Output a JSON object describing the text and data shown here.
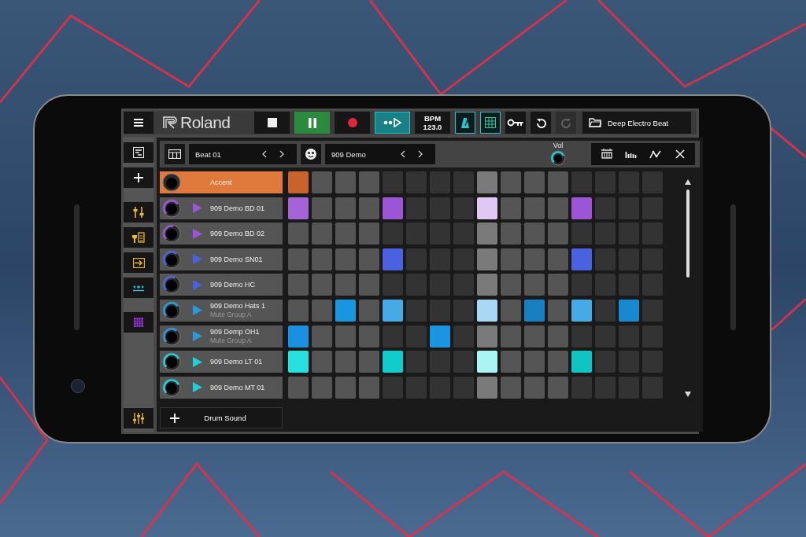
{
  "top_bar": {
    "logo": {
      "text": "Roland"
    },
    "transport": [
      {
        "kind": "stop",
        "on": false
      },
      {
        "kind": "pause",
        "on": true
      },
      {
        "kind": "record",
        "on": false
      },
      {
        "kind": "step",
        "on": true
      }
    ],
    "bpm": {
      "label": "BPM",
      "value": "123.0"
    },
    "toggles": [
      {
        "kind": "metronome",
        "on": true
      },
      {
        "kind": "grid",
        "on": true
      }
    ],
    "tools": [
      {
        "kind": "key",
        "disabled": false
      },
      {
        "kind": "undo",
        "disabled": false
      },
      {
        "kind": "redo",
        "disabled": true
      }
    ],
    "project": "Deep Electro Beat"
  },
  "sidebar": {
    "groups": [
      {
        "items": [
          {
            "kind": "list"
          },
          {
            "kind": "add"
          }
        ]
      },
      {
        "items": [
          {
            "kind": "tune"
          },
          {
            "kind": "edit"
          },
          {
            "kind": "import"
          },
          {
            "kind": "arrange"
          }
        ]
      },
      {
        "items": [
          {
            "kind": "grid"
          }
        ]
      },
      {
        "items": [
          {
            "kind": "mixer"
          }
        ]
      }
    ]
  },
  "pattern_bar": {
    "pattern": "Beat 01",
    "kit": "909 Demo",
    "volume": {
      "label": "Vol",
      "level": 0.75
    },
    "view_buttons": [
      {
        "kind": "drum-kit"
      },
      {
        "kind": "velocity"
      },
      {
        "kind": "automation"
      },
      {
        "kind": "close"
      }
    ]
  },
  "step_columns": [
    {
      "current": false
    },
    {
      "current": false
    },
    {
      "current": false
    },
    {
      "current": false
    },
    {
      "current": false
    },
    {
      "current": false
    },
    {
      "current": false
    },
    {
      "current": false
    },
    {
      "current": true
    },
    {
      "current": false
    },
    {
      "current": false
    },
    {
      "current": false
    },
    {
      "current": false
    },
    {
      "current": false
    },
    {
      "current": false
    },
    {
      "current": false
    }
  ],
  "tracks": [
    {
      "kind": "accent",
      "name": "Accent",
      "selected": true,
      "steps": [
        {
          "on": true,
          "color": "#c8632e"
        },
        {
          "on": false
        },
        {
          "on": false
        },
        {
          "on": false
        },
        {
          "on": false
        },
        {
          "on": false
        },
        {
          "on": false
        },
        {
          "on": false
        },
        {
          "on": false
        },
        {
          "on": false
        },
        {
          "on": false
        },
        {
          "on": false
        },
        {
          "on": false
        },
        {
          "on": false
        },
        {
          "on": false
        },
        {
          "on": false
        }
      ]
    },
    {
      "kind": "sound",
      "name": "909 Demo BD 01",
      "selected": false,
      "color": "#9b55d6",
      "level": 0.7,
      "steps": [
        {
          "on": true,
          "color": "#a464d8"
        },
        {
          "on": false
        },
        {
          "on": false
        },
        {
          "on": false
        },
        {
          "on": true,
          "color": "#9b55d6"
        },
        {
          "on": false
        },
        {
          "on": false
        },
        {
          "on": false
        },
        {
          "on": true,
          "color": "#e0c8f4"
        },
        {
          "on": false
        },
        {
          "on": false
        },
        {
          "on": false
        },
        {
          "on": true,
          "color": "#9b55d6"
        },
        {
          "on": false
        },
        {
          "on": false
        },
        {
          "on": false
        }
      ]
    },
    {
      "kind": "sound",
      "name": "909 Demo BD 02",
      "selected": false,
      "color": "#9b55d6",
      "level": 0.55,
      "steps": [
        {
          "on": false
        },
        {
          "on": false
        },
        {
          "on": false
        },
        {
          "on": false
        },
        {
          "on": false
        },
        {
          "on": false
        },
        {
          "on": false
        },
        {
          "on": false
        },
        {
          "on": false
        },
        {
          "on": false
        },
        {
          "on": false
        },
        {
          "on": false
        },
        {
          "on": false
        },
        {
          "on": false
        },
        {
          "on": false
        },
        {
          "on": false
        }
      ]
    },
    {
      "kind": "sound",
      "name": "909 Demo SN01",
      "selected": false,
      "color": "#4a62e0",
      "level": 0.65,
      "steps": [
        {
          "on": false
        },
        {
          "on": false
        },
        {
          "on": false
        },
        {
          "on": false
        },
        {
          "on": true,
          "color": "#4a62e0"
        },
        {
          "on": false
        },
        {
          "on": false
        },
        {
          "on": false
        },
        {
          "on": false
        },
        {
          "on": false
        },
        {
          "on": false
        },
        {
          "on": false
        },
        {
          "on": true,
          "color": "#4a62e0"
        },
        {
          "on": false
        },
        {
          "on": false
        },
        {
          "on": false
        }
      ]
    },
    {
      "kind": "sound",
      "name": "909 Demo HC",
      "selected": false,
      "color": "#4a62e0",
      "level": 0.6,
      "steps": [
        {
          "on": false
        },
        {
          "on": false
        },
        {
          "on": false
        },
        {
          "on": false
        },
        {
          "on": false
        },
        {
          "on": false
        },
        {
          "on": false
        },
        {
          "on": false
        },
        {
          "on": false
        },
        {
          "on": false
        },
        {
          "on": false
        },
        {
          "on": false
        },
        {
          "on": false
        },
        {
          "on": false
        },
        {
          "on": false
        },
        {
          "on": false
        }
      ]
    },
    {
      "kind": "sound",
      "name": "909 Demo Hats 1",
      "subtitle": "Mute Group A",
      "selected": false,
      "color": "#2a9ae0",
      "level": 0.7,
      "steps": [
        {
          "on": false
        },
        {
          "on": false
        },
        {
          "on": true,
          "color": "#1a96e0"
        },
        {
          "on": false
        },
        {
          "on": true,
          "color": "#45aae6"
        },
        {
          "on": false
        },
        {
          "on": false
        },
        {
          "on": false
        },
        {
          "on": true,
          "color": "#a8d8f4"
        },
        {
          "on": false
        },
        {
          "on": true,
          "color": "#1880c0"
        },
        {
          "on": false
        },
        {
          "on": true,
          "color": "#45aae6"
        },
        {
          "on": false
        },
        {
          "on": true,
          "color": "#1888d0"
        },
        {
          "on": false
        }
      ]
    },
    {
      "kind": "sound",
      "name": "909 Demp OH1",
      "subtitle": "Mute Group A",
      "selected": false,
      "color": "#2a9ae0",
      "level": 0.65,
      "steps": [
        {
          "on": true,
          "color": "#1a90e0"
        },
        {
          "on": false
        },
        {
          "on": false
        },
        {
          "on": false
        },
        {
          "on": false
        },
        {
          "on": false
        },
        {
          "on": true,
          "color": "#1a96e0"
        },
        {
          "on": false
        },
        {
          "on": false
        },
        {
          "on": false
        },
        {
          "on": false
        },
        {
          "on": false
        },
        {
          "on": false
        },
        {
          "on": false
        },
        {
          "on": false
        },
        {
          "on": false
        }
      ]
    },
    {
      "kind": "sound",
      "name": "909 Demo LT 01",
      "selected": false,
      "color": "#20d0d8",
      "level": 0.75,
      "steps": [
        {
          "on": true,
          "color": "#28e0e0"
        },
        {
          "on": false
        },
        {
          "on": false
        },
        {
          "on": false
        },
        {
          "on": true,
          "color": "#10cccc"
        },
        {
          "on": false
        },
        {
          "on": false
        },
        {
          "on": false
        },
        {
          "on": true,
          "color": "#aaf4f4"
        },
        {
          "on": false
        },
        {
          "on": false
        },
        {
          "on": false
        },
        {
          "on": true,
          "color": "#10c4c4"
        },
        {
          "on": false
        },
        {
          "on": false
        },
        {
          "on": false
        }
      ]
    },
    {
      "kind": "sound",
      "name": "909 Demo MT 01",
      "selected": false,
      "color": "#20d0d8",
      "level": 0.75,
      "steps": [
        {
          "on": false
        },
        {
          "on": false
        },
        {
          "on": false
        },
        {
          "on": false
        },
        {
          "on": false
        },
        {
          "on": false
        },
        {
          "on": false
        },
        {
          "on": false
        },
        {
          "on": false
        },
        {
          "on": false
        },
        {
          "on": false
        },
        {
          "on": false
        },
        {
          "on": false
        },
        {
          "on": false
        },
        {
          "on": false
        },
        {
          "on": false
        }
      ]
    }
  ],
  "add_sound": {
    "label": "Drum Sound"
  }
}
